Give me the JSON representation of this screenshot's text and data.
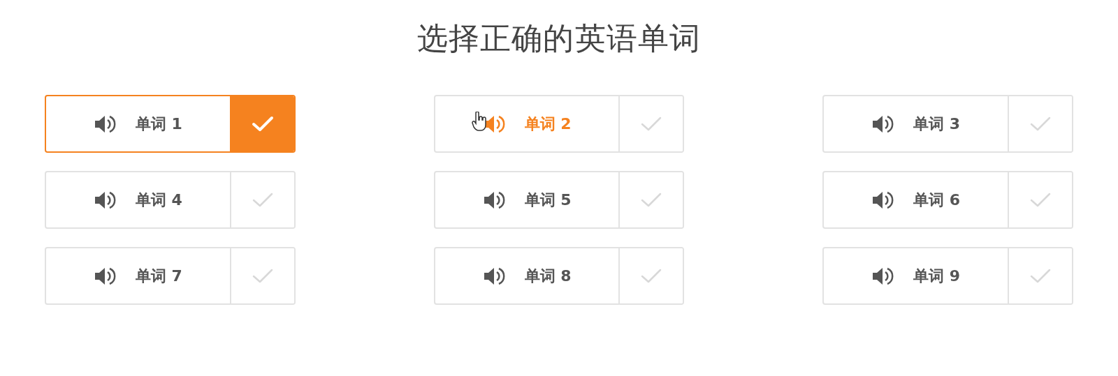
{
  "title": "选择正确的英语单词",
  "options": [
    {
      "label": "单词 1",
      "selected": true,
      "hovered": false
    },
    {
      "label": "单词 2",
      "selected": false,
      "hovered": true
    },
    {
      "label": "单词 3",
      "selected": false,
      "hovered": false
    },
    {
      "label": "单词 4",
      "selected": false,
      "hovered": false
    },
    {
      "label": "单词 5",
      "selected": false,
      "hovered": false
    },
    {
      "label": "单词 6",
      "selected": false,
      "hovered": false
    },
    {
      "label": "单词 7",
      "selected": false,
      "hovered": false
    },
    {
      "label": "单词 8",
      "selected": false,
      "hovered": false
    },
    {
      "label": "单词 9",
      "selected": false,
      "hovered": false
    }
  ]
}
